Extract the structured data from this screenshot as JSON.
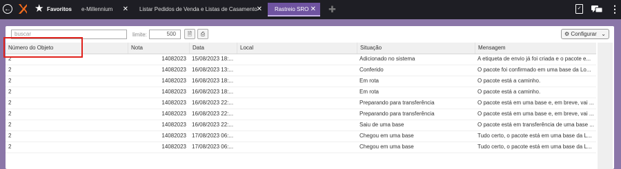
{
  "topbar": {
    "favorites_label": "Favoritos",
    "tabs": [
      {
        "label": "e-Millennium"
      },
      {
        "label": "Listar Pedidos de Venda e Listas de Casamento"
      },
      {
        "label": "Rastreio SRO"
      }
    ],
    "active_tab_index": 2
  },
  "toolbar": {
    "search_placeholder": "buscar",
    "limit_label": "limite:",
    "limit_value": "500",
    "config_label": "Configurar"
  },
  "table": {
    "columns": [
      "Número do Objeto",
      "Nota",
      "Data",
      "Local",
      "Situação",
      "Mensagem"
    ],
    "rows": [
      [
        "2",
        "14082023",
        "15/08/2023 18:...",
        "",
        "Adicionado no sistema",
        "A etiqueta de envio já foi criada e o pacote e..."
      ],
      [
        "2",
        "14082023",
        "16/08/2023 13:...",
        "",
        "Conferido",
        "O pacote foi confirmado em uma base da Lo..."
      ],
      [
        "2",
        "14082023",
        "16/08/2023 18:...",
        "",
        "Em rota",
        "O pacote está a caminho."
      ],
      [
        "2",
        "14082023",
        "16/08/2023 18:...",
        "",
        "Em rota",
        "O pacote está a caminho."
      ],
      [
        "2",
        "14082023",
        "16/08/2023 22:...",
        "",
        "Preparando para transferência",
        "O pacote está em uma base e, em breve, vai ..."
      ],
      [
        "2",
        "14082023",
        "16/08/2023 22:...",
        "",
        "Preparando para transferência",
        "O pacote está em uma base e, em breve, vai ..."
      ],
      [
        "2",
        "14082023",
        "16/08/2023 22:...",
        "",
        "Saiu de uma base",
        "O pacote está em transferência de uma base ..."
      ],
      [
        "2",
        "14082023",
        "17/08/2023 06:...",
        "",
        "Chegou em uma base",
        "Tudo certo, o pacote está em uma base da L..."
      ],
      [
        "2",
        "14082023",
        "17/08/2023 06:...",
        "",
        "Chegou em uma base",
        "Tudo certo, o pacote está em uma base da L..."
      ]
    ]
  },
  "icons": {
    "back": "back-arrow-icon",
    "logo": "app-logo-icon",
    "favorites": "star-icon",
    "export": "document-icon",
    "print": "printer-icon",
    "config": "gear-icon",
    "clipboard": "clipboard-icon",
    "chat": "chat-icon",
    "menu": "kebab-menu-icon"
  },
  "colors": {
    "topbar": "#1e1e24",
    "active_tab": "#6f53a0",
    "background": "#8b76a8",
    "highlight": "#e0201a"
  }
}
